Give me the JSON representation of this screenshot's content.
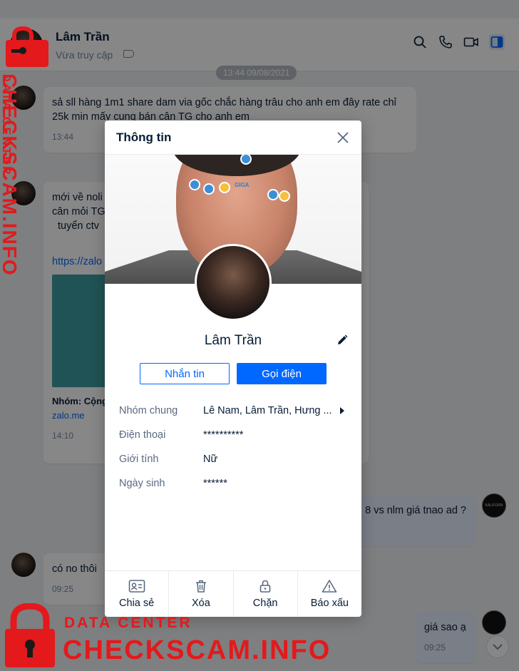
{
  "header": {
    "name": "Lâm Trần",
    "status": "Vừa truy cập"
  },
  "chat": {
    "date_divider": "13:44 09/08/2021",
    "messages": [
      {
        "text": "sả sll hàng 1m1 share dam via gốc chắc hàng trâu cho anh em đây rate chỉ 25k min mấy cung bán cân TG cho anh em",
        "time": "13:44"
      },
      {
        "line1": "mới về noli",
        "line2": "cân mỏi TG",
        "line3": "tuyển ctv",
        "link": "https://zalo",
        "card_title": "Nhóm: Cộng",
        "card_domain": "zalo.me",
        "time": "14:10"
      },
      {
        "text": "8 vs nlm giá tnao ad ?",
        "avatar_text": "KALIFORN"
      },
      {
        "text": "có no thôi",
        "time": "09:25"
      },
      {
        "text": "giá sao ạ",
        "time": "09:25"
      }
    ]
  },
  "modal": {
    "title": "Thông tin",
    "cover_sticker_text": "GIGA",
    "profile_name": "Lâm Trần",
    "message_button": "Nhắn tin",
    "call_button": "Gọi điện",
    "info": [
      {
        "label": "Nhóm chung",
        "value": "Lê Nam, Lâm Trần, Hưng ..."
      },
      {
        "label": "Điện thoại",
        "value": "**********"
      },
      {
        "label": "Giới tính",
        "value": "Nữ"
      },
      {
        "label": "Ngày sinh",
        "value": "******"
      }
    ],
    "actions": [
      {
        "label": "Chia sẻ",
        "icon": "contact-card-icon"
      },
      {
        "label": "Xóa",
        "icon": "trash-icon"
      },
      {
        "label": "Chặn",
        "icon": "lock-icon"
      },
      {
        "label": "Báo xấu",
        "icon": "warning-icon"
      }
    ]
  },
  "watermark": {
    "vertical_small": "DATA CENTER",
    "vertical_big": "CHECKSCAM.INFO",
    "bottom_small": "DATA CENTER",
    "bottom_big": "CHECKSCAM.INFO",
    "color": "#e3191c"
  },
  "colors": {
    "accent": "#0068ff",
    "text": "#081c36",
    "muted": "#7589a3"
  }
}
